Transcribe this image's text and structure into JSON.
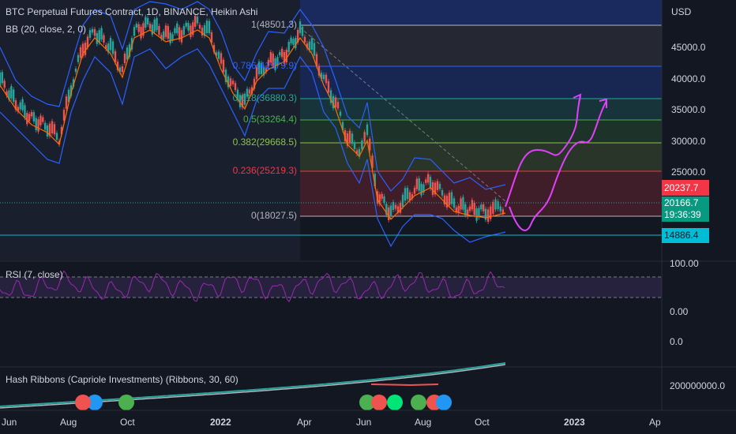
{
  "header": {
    "title": "BTC Perpetual Futures Contract, 1D, BINANCE, Heikin Ashi",
    "bb_label": "BB (20, close, 2, 0)"
  },
  "axis": {
    "currency": "USD",
    "price_ticks": [
      "45000.0",
      "40000.0",
      "35000.0",
      "30000.0",
      "25000.0"
    ],
    "date_ticks": [
      "Jun",
      "Aug",
      "Oct",
      "2022",
      "Apr",
      "Jun",
      "Aug",
      "Oct",
      "2023",
      "Ap"
    ]
  },
  "fib": {
    "levels": [
      {
        "label": "1(48501.3)",
        "color": "#b2b5be",
        "band": "rgba(120,123,134,0.18)"
      },
      {
        "label": "0.786(41979.9)",
        "color": "#2962ff",
        "band": "rgba(41,98,255,0.22)"
      },
      {
        "label": "0.618(36880.3)",
        "color": "#22ab94",
        "band": "rgba(34,171,148,0.20)"
      },
      {
        "label": "0.5(33264.4)",
        "color": "#4caf50",
        "band": "rgba(76,175,80,0.18)"
      },
      {
        "label": "0.382(29668.5)",
        "color": "#8bc34a",
        "band": "rgba(139,195,74,0.18)"
      },
      {
        "label": "0.236(25219.3)",
        "color": "#f23645",
        "band": "rgba(242,54,69,0.20)"
      },
      {
        "label": "0(18027.5)",
        "color": "#b2b5be",
        "band": ""
      }
    ]
  },
  "price_labels": {
    "red_price": "20237.7",
    "current_price": "20166.7",
    "countdown": "19:36:39",
    "support_price": "14886.4"
  },
  "rsi": {
    "label": "RSI (7, close)",
    "ticks": [
      "100.00",
      "0.00",
      "0.0"
    ]
  },
  "hash": {
    "label": "Hash Ribbons (Capriole Investments) (Ribbons, 30, 60)",
    "tick": "200000000.0"
  },
  "colors": {
    "background": "#131722",
    "bullish": "#26a69a",
    "bearish": "#ef5350",
    "bb_band": "#2962ff",
    "bb_basis": "#ff6d00",
    "projection": "#e040fb",
    "rsi_line": "#9c27b0"
  }
}
